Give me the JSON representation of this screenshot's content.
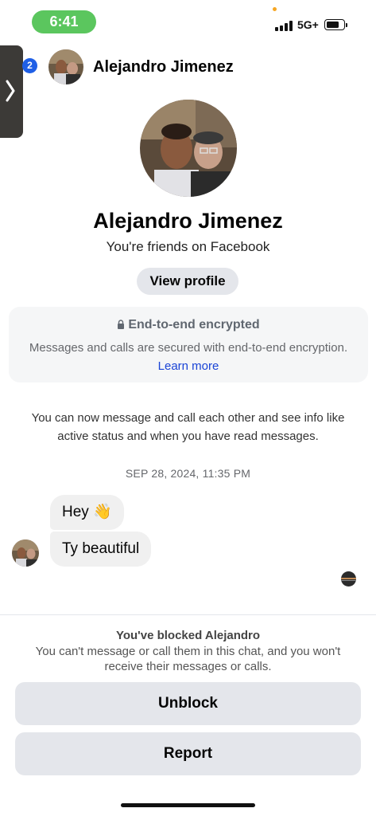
{
  "status_bar": {
    "time": "6:41",
    "network": "5G+",
    "time_pill_color": "#5bc65e"
  },
  "header": {
    "unread_badge": "2",
    "contact_name": "Alejandro Jimenez",
    "avatar": "profile-photo-two-men"
  },
  "profile": {
    "name": "Alejandro Jimenez",
    "subtitle": "You're friends on Facebook",
    "view_profile_label": "View profile",
    "avatar": "profile-photo-two-men"
  },
  "encryption": {
    "title": "End-to-end encrypted",
    "body": "Messages and calls are secured with end-to-end encryption.",
    "link": "Learn more",
    "link_color": "#1a44d6"
  },
  "info_text": "You can now message and call each other and see info like active status and when you have read messages.",
  "timestamp": "SEP 28, 2024, 11:35 PM",
  "messages": [
    {
      "text": "Hey 👋"
    },
    {
      "text": "Ty beautiful"
    }
  ],
  "blocked": {
    "title": "You've blocked Alejandro",
    "description": "You can't message or call them in this chat, and you won't receive their messages or calls.",
    "unblock_label": "Unblock",
    "report_label": "Report"
  },
  "icons": {
    "side_tab": "chevron-right-icon",
    "lock": "lock-icon",
    "signal": "signal-bars-icon",
    "battery": "battery-icon"
  }
}
